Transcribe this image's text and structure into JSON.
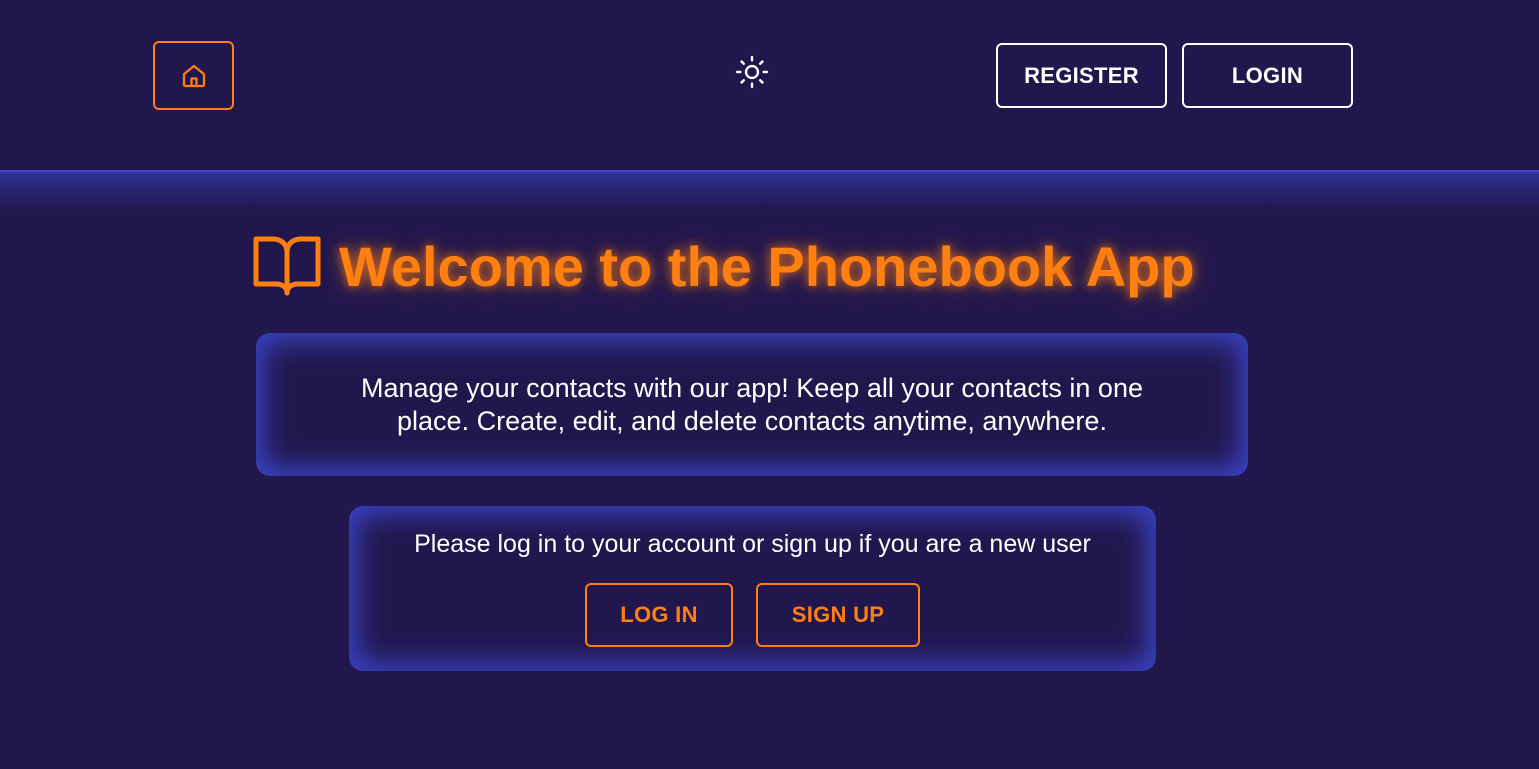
{
  "colors": {
    "background": "#22174d",
    "accent": "#ff7f11",
    "glow": "#3a45c8",
    "text": "#ffffff"
  },
  "header": {
    "home_icon": "home-icon",
    "theme_icon": "sun-icon",
    "register_label": "REGISTER",
    "login_label": "LOGIN"
  },
  "main": {
    "title_icon": "book-open-icon",
    "title": "Welcome to the Phonebook App",
    "intro_text": "Manage your contacts with our app! Keep all your contacts in one place. Create, edit, and delete contacts anytime, anywhere.",
    "auth_prompt": "Please log in to your account or sign up if you are a new user",
    "login_label": "LOG IN",
    "signup_label": "SIGN UP"
  }
}
